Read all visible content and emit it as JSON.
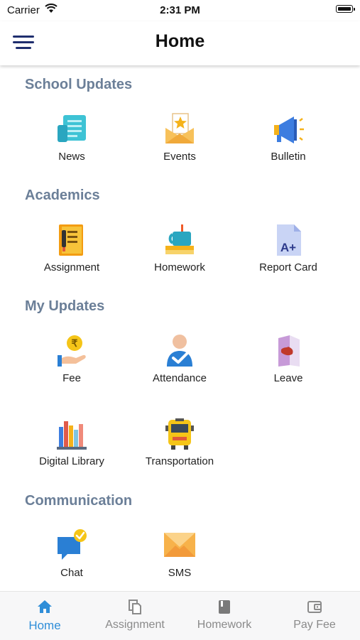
{
  "status_bar": {
    "carrier": "Carrier",
    "time": "2:31 PM"
  },
  "nav": {
    "title": "Home"
  },
  "sections": {
    "school_updates": {
      "title": "School Updates",
      "items": [
        {
          "label": "News"
        },
        {
          "label": "Events"
        },
        {
          "label": "Bulletin"
        }
      ]
    },
    "academics": {
      "title": "Academics",
      "items": [
        {
          "label": "Assignment"
        },
        {
          "label": "Homework"
        },
        {
          "label": "Report Card"
        }
      ]
    },
    "my_updates": {
      "title": "My Updates",
      "items": [
        {
          "label": "Fee"
        },
        {
          "label": "Attendance"
        },
        {
          "label": "Leave"
        },
        {
          "label": "Digital Library"
        },
        {
          "label": "Transportation"
        }
      ]
    },
    "communication": {
      "title": "Communication",
      "items": [
        {
          "label": "Chat"
        },
        {
          "label": "SMS"
        }
      ]
    }
  },
  "tab_bar": {
    "tabs": [
      {
        "label": "Home",
        "active": true
      },
      {
        "label": "Assignment",
        "active": false
      },
      {
        "label": "Homework",
        "active": false
      },
      {
        "label": "Pay Fee",
        "active": false
      }
    ]
  },
  "colors": {
    "accent": "#2f8ed8",
    "section_title": "#6b7f98",
    "menu_icon": "#1f2e6e"
  }
}
